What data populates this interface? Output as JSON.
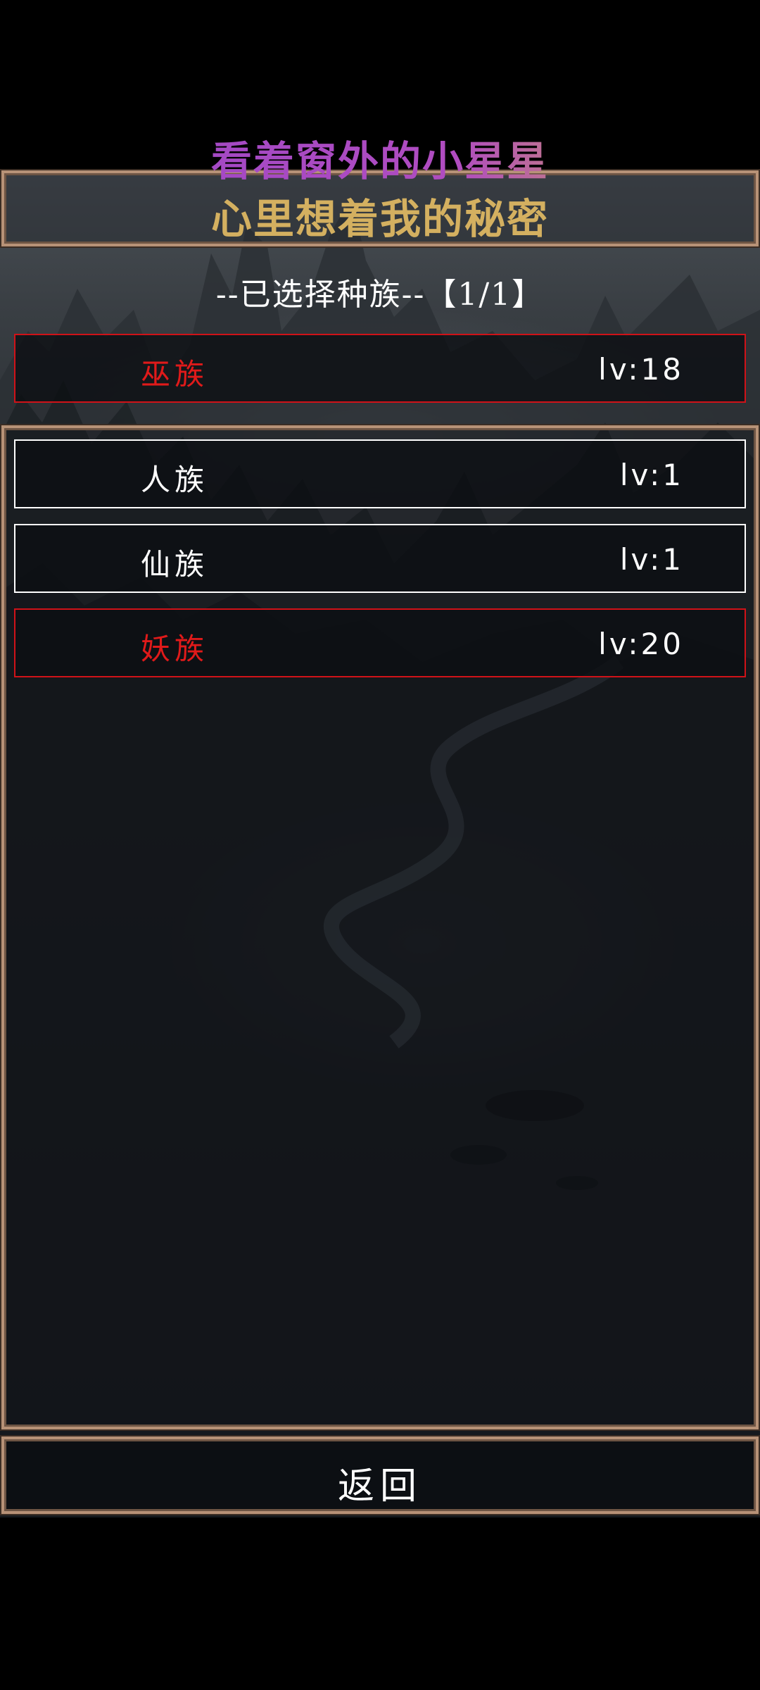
{
  "title": {
    "line1": "看着窗外的小星星",
    "line2": "心里想着我的秘密"
  },
  "selected_header": "--已选择种族--【1/1】",
  "selected_races": [
    {
      "name": "巫族",
      "level": "lv:18"
    }
  ],
  "race_list": [
    {
      "name": "人族",
      "level": "lv:1"
    },
    {
      "name": "仙族",
      "level": "lv:1"
    },
    {
      "name": "妖族",
      "level": "lv:20"
    }
  ],
  "back_button": {
    "label": "返回"
  },
  "colors": {
    "frame_border": "#b79277",
    "selected_border": "#d01218",
    "highlight_text": "#e01a1a",
    "title_purple": "#a24cc8",
    "title_gold": "#d4b060"
  }
}
